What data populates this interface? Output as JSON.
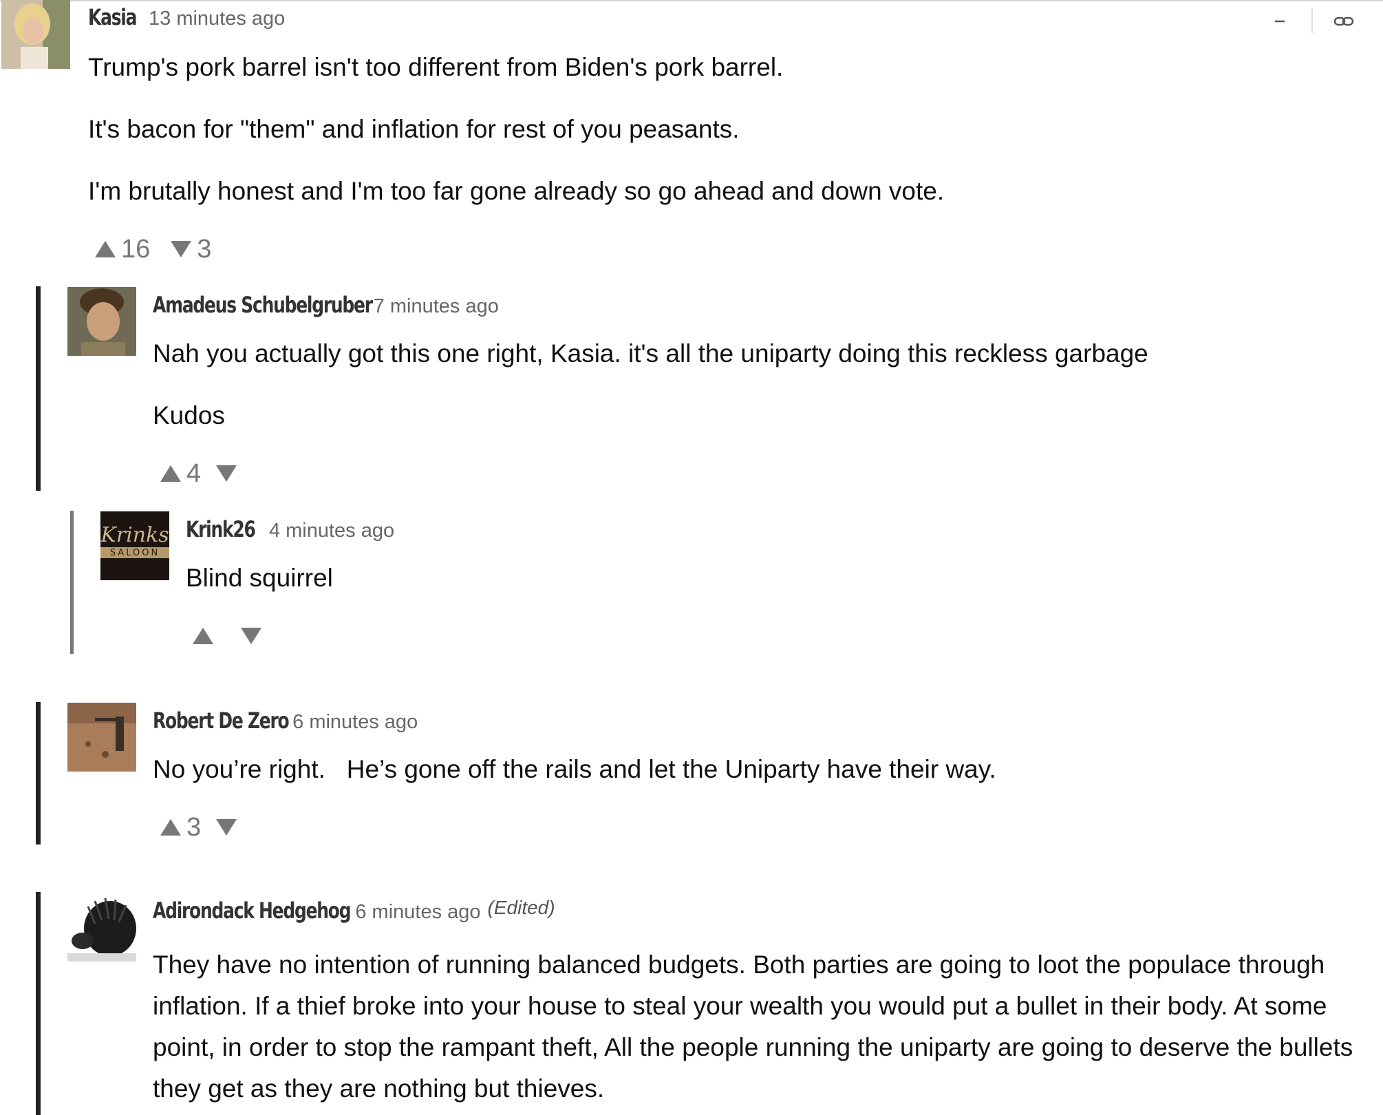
{
  "comments": [
    {
      "author": "Kasia",
      "time": "13 minutes ago",
      "body": [
        "Trump's pork barrel isn't too different from Biden's pork barrel.",
        "It's bacon for \"them\" and inflation for rest of you peasants.",
        "I'm brutally honest and I'm too far gone already so go ahead and down vote."
      ],
      "upvotes": "16",
      "downvotes": "3"
    },
    {
      "author": "Amadeus Schubelgruber",
      "time": "7 minutes ago",
      "body": [
        "Nah you actually got this one right, Kasia. it's all the uniparty doing this reckless garbage",
        "Kudos"
      ],
      "upvotes": "4",
      "downvotes": ""
    },
    {
      "author": "Krink26",
      "time": "4 minutes ago",
      "avatar_text": "Krinks SALOON",
      "body": [
        "Blind squirrel"
      ],
      "upvotes": "",
      "downvotes": ""
    },
    {
      "author": "Robert De Zero",
      "time": "6 minutes ago",
      "body": [
        "No you’re right.   He’s gone off the rails and let the Uniparty have their way."
      ],
      "upvotes": "3",
      "downvotes": ""
    },
    {
      "author": "Adirondack Hedgehog",
      "time": "6 minutes ago",
      "edited": "(Edited)",
      "body": [
        "They have no intention of running balanced budgets. Both parties are going to loot the populace through inflation. If a thief broke into your house to steal your wealth you would put a bullet in their body. At some point, in order to stop the rampant theft, All the people running the uniparty are going to deserve the bullets they get as they are nothing but thieves."
      ],
      "upvotes": "",
      "downvotes": ""
    }
  ],
  "controls": {
    "collapse": "minus-icon",
    "permalink": "link-icon"
  },
  "colors": {
    "text": "#111111",
    "meta": "#666666",
    "vote": "#777777",
    "thread_bar": "#222222"
  }
}
